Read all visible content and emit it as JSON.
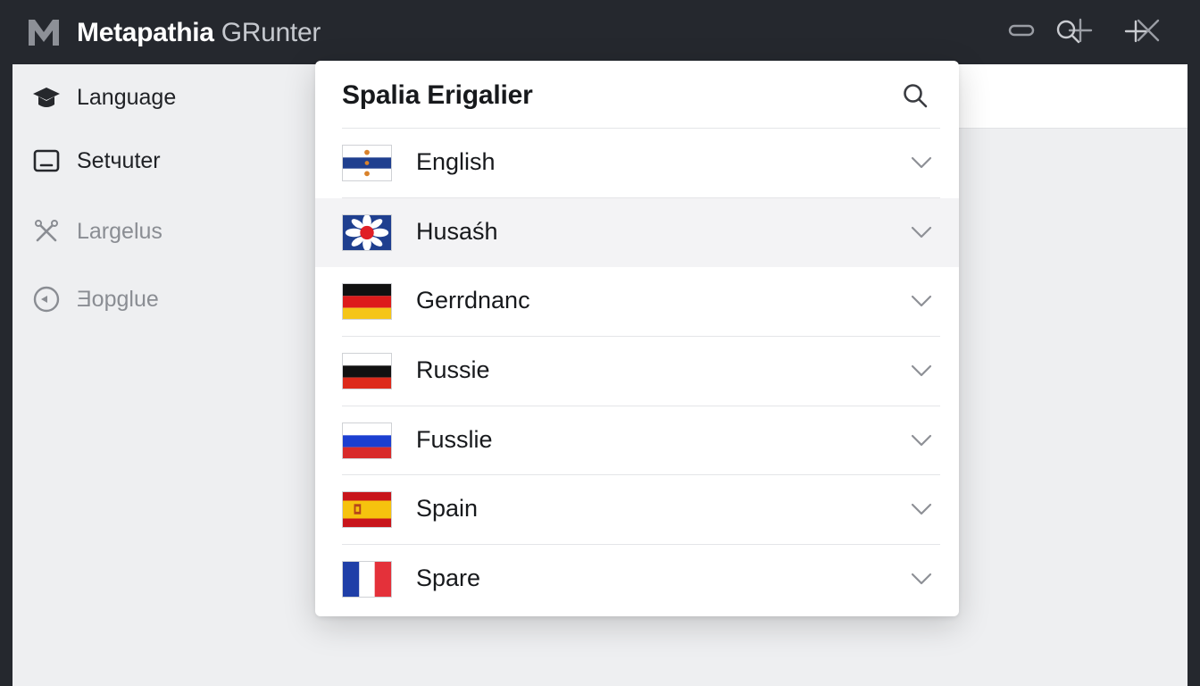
{
  "app": {
    "logo": "m-logo-icon",
    "title_bold": "Metapathia",
    "title_light": " GRunter",
    "window_controls": [
      "minimize-icon",
      "maximize-icon",
      "close-icon"
    ]
  },
  "toolbar": {
    "icons": [
      "search-icon",
      "plus-icon"
    ]
  },
  "sidebar": {
    "items": [
      {
        "label": "Language",
        "icon": "graduation-cap-icon",
        "dimmed": false
      },
      {
        "label": "Setчuter",
        "icon": "monitor-icon",
        "dimmed": false
      },
      {
        "label": "Largelus",
        "icon": "tools-icon",
        "dimmed": true
      },
      {
        "label": "Ǝopglue",
        "icon": "refresh-circle-icon",
        "dimmed": true
      }
    ]
  },
  "dropdown": {
    "title": "Spalia Erigalier",
    "search_icon": "search-icon",
    "languages": [
      {
        "name": "English",
        "flag": "blue-white-emblem-flag",
        "highlighted": false
      },
      {
        "name": "Husaśh",
        "flag": "red-sun-emblem-flag",
        "highlighted": true
      },
      {
        "name": "Gerrdnanc",
        "flag": "black-red-gold-flag",
        "highlighted": false
      },
      {
        "name": "Russie",
        "flag": "white-black-red-flag",
        "highlighted": false
      },
      {
        "name": "Fusslie",
        "flag": "white-blue-red-flag",
        "highlighted": false
      },
      {
        "name": "Spain",
        "flag": "red-yellow-red-flag",
        "highlighted": false
      },
      {
        "name": "Spare",
        "flag": "blue-white-red-vertical-flag",
        "highlighted": false
      }
    ]
  },
  "colors": {
    "titlebar_bg": "#25282e",
    "window_bg": "#eeeff1",
    "panel_bg": "#ffffff",
    "highlight_row": "#f3f3f5"
  }
}
